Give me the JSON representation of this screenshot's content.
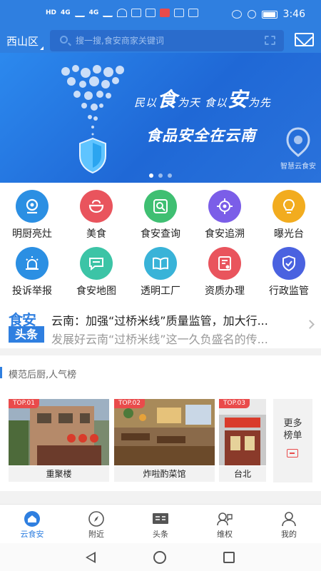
{
  "status_bar": {
    "network_labels": [
      "HD",
      "4G",
      "4G"
    ],
    "time": "3:46"
  },
  "header": {
    "district": "西山区",
    "search_placeholder": "搜一搜,食安商家关键词"
  },
  "banner": {
    "slogan_line1": [
      "民以",
      "食",
      "为天 食以",
      "安",
      "为先"
    ],
    "slogan_line2": "食品安全在云南",
    "logo_text": "智慧云食安",
    "page_count": 3,
    "active_page": 1
  },
  "grid": [
    {
      "label": "明厨亮灶",
      "color": "#2b8fe3",
      "icon": "camera-icon"
    },
    {
      "label": "美食",
      "color": "#e9545d",
      "icon": "bowl-icon"
    },
    {
      "label": "食安查询",
      "color": "#3fbf72",
      "icon": "search-icon"
    },
    {
      "label": "食安追溯",
      "color": "#7b5ee8",
      "icon": "target-icon"
    },
    {
      "label": "曝光台",
      "color": "#f2ac1f",
      "icon": "lightbulb-icon"
    },
    {
      "label": "投诉举报",
      "color": "#2b8fe3",
      "icon": "alarm-icon"
    },
    {
      "label": "食安地图",
      "color": "#3cc4a6",
      "icon": "chat-icon"
    },
    {
      "label": "透明工厂",
      "color": "#39b3d8",
      "icon": "book-icon"
    },
    {
      "label": "资质办理",
      "color": "#e9545d",
      "icon": "certificate-icon"
    },
    {
      "label": "行政监管",
      "color": "#4a62e0",
      "icon": "shield-check-icon"
    }
  ],
  "headline": {
    "logo_top": "食安",
    "logo_bottom": "头条",
    "title": "云南：加强“过桥米线”质量监管，加大行...",
    "subtitle": "发展好云南“过桥米线”这一久负盛名的传..."
  },
  "ranking": {
    "title": "模范后厨,人气榜",
    "items": [
      {
        "tag": "TOP.01",
        "name": "重聚楼"
      },
      {
        "tag": "TOP.02",
        "name": "炸啦酌菜馆"
      },
      {
        "tag": "TOP.03",
        "name": "台北"
      }
    ],
    "more_label_line1": "更多",
    "more_label_line2": "榜单"
  },
  "bottom_nav": [
    {
      "label": "云食安",
      "icon": "home-icon",
      "active": true
    },
    {
      "label": "附近",
      "icon": "compass-icon",
      "active": false
    },
    {
      "label": "头条",
      "icon": "headline-icon",
      "active": false
    },
    {
      "label": "维权",
      "icon": "support-icon",
      "active": false
    },
    {
      "label": "我的",
      "icon": "user-icon",
      "active": false
    }
  ],
  "colors": {
    "brand_blue": "#2f7fe0",
    "tag_red": "#e94b4b",
    "text_dark": "#222222",
    "text_gray": "#999999"
  }
}
